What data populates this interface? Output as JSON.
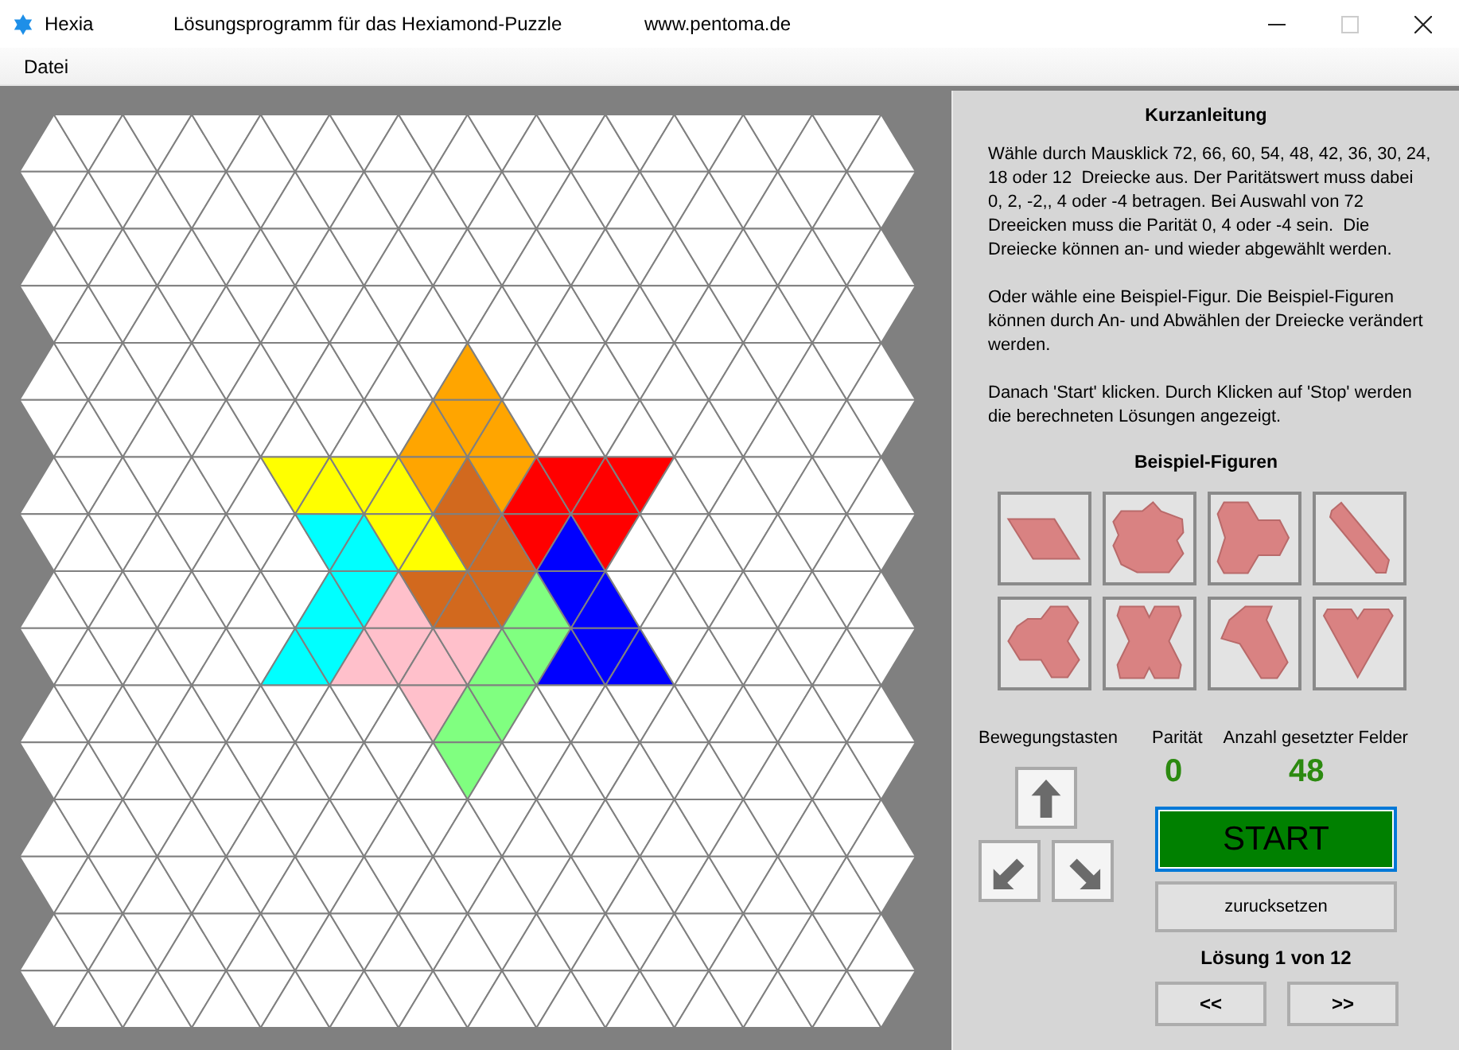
{
  "window": {
    "app_name": "Hexia",
    "title": "Lösungsprogramm für das Hexiamond-Puzzle",
    "url": "www.pentoma.de",
    "controls": [
      {
        "kind": "minimize",
        "disabled": false
      },
      {
        "kind": "maximize",
        "disabled": true
      },
      {
        "kind": "close",
        "disabled": false
      }
    ]
  },
  "menu": [
    "Datei"
  ],
  "board": {
    "rows": [
      {
        "cells": [
          {
            "selected": false
          },
          {
            "selected": false
          },
          {
            "selected": false
          },
          {
            "selected": false
          },
          {
            "selected": false
          },
          {
            "selected": false
          },
          {
            "selected": false
          },
          {
            "selected": false
          },
          {
            "selected": false
          },
          {
            "selected": false
          },
          {
            "selected": false
          },
          {
            "selected": false
          },
          {
            "selected": false
          },
          {
            "selected": false
          },
          {
            "selected": false
          },
          {
            "selected": false
          },
          {
            "selected": false
          },
          {
            "selected": false
          },
          {
            "selected": false
          },
          {
            "selected": false
          },
          {
            "selected": false
          },
          {
            "selected": false
          },
          {
            "selected": false
          },
          {
            "selected": false
          },
          {
            "selected": false
          }
        ]
      },
      {
        "cells": [
          {
            "selected": false
          },
          {
            "selected": false
          },
          {
            "selected": false
          },
          {
            "selected": false
          },
          {
            "selected": false
          },
          {
            "selected": false
          },
          {
            "selected": false
          },
          {
            "selected": false
          },
          {
            "selected": false
          },
          {
            "selected": false
          },
          {
            "selected": false
          },
          {
            "selected": false
          },
          {
            "selected": false
          },
          {
            "selected": false
          },
          {
            "selected": false
          },
          {
            "selected": false
          },
          {
            "selected": false
          },
          {
            "selected": false
          },
          {
            "selected": false
          },
          {
            "selected": false
          },
          {
            "selected": false
          },
          {
            "selected": false
          },
          {
            "selected": false
          },
          {
            "selected": false
          },
          {
            "selected": false
          }
        ]
      },
      {
        "cells": [
          {
            "selected": false
          },
          {
            "selected": false
          },
          {
            "selected": false
          },
          {
            "selected": false
          },
          {
            "selected": false
          },
          {
            "selected": false
          },
          {
            "selected": false
          },
          {
            "selected": false
          },
          {
            "selected": false
          },
          {
            "selected": false
          },
          {
            "selected": false
          },
          {
            "selected": false
          },
          {
            "selected": false
          },
          {
            "selected": false
          },
          {
            "selected": false
          },
          {
            "selected": false
          },
          {
            "selected": false
          },
          {
            "selected": false
          },
          {
            "selected": false
          },
          {
            "selected": false
          },
          {
            "selected": false
          },
          {
            "selected": false
          },
          {
            "selected": false
          },
          {
            "selected": false
          },
          {
            "selected": false
          }
        ]
      },
      {
        "cells": [
          {
            "selected": false
          },
          {
            "selected": false
          },
          {
            "selected": false
          },
          {
            "selected": false
          },
          {
            "selected": false
          },
          {
            "selected": false
          },
          {
            "selected": false
          },
          {
            "selected": false
          },
          {
            "selected": false
          },
          {
            "selected": false
          },
          {
            "selected": false
          },
          {
            "selected": false
          },
          {
            "selected": false
          },
          {
            "selected": false
          },
          {
            "selected": false
          },
          {
            "selected": false
          },
          {
            "selected": false
          },
          {
            "selected": false
          },
          {
            "selected": false
          },
          {
            "selected": false
          },
          {
            "selected": false
          },
          {
            "selected": false
          },
          {
            "selected": false
          },
          {
            "selected": false
          },
          {
            "selected": false
          }
        ]
      },
      {
        "cells": [
          {
            "selected": false
          },
          {
            "selected": false
          },
          {
            "selected": false
          },
          {
            "selected": false
          },
          {
            "selected": false
          },
          {
            "selected": false
          },
          {
            "selected": false
          },
          {
            "selected": false
          },
          {
            "selected": false
          },
          {
            "selected": false
          },
          {
            "selected": false
          },
          {
            "selected": false
          },
          {
            "selected": true,
            "color": "#ffa500"
          },
          {
            "selected": false
          },
          {
            "selected": false
          },
          {
            "selected": false
          },
          {
            "selected": false
          },
          {
            "selected": false
          },
          {
            "selected": false
          },
          {
            "selected": false
          },
          {
            "selected": false
          },
          {
            "selected": false
          },
          {
            "selected": false
          },
          {
            "selected": false
          },
          {
            "selected": false
          }
        ]
      },
      {
        "cells": [
          {
            "selected": false
          },
          {
            "selected": false
          },
          {
            "selected": false
          },
          {
            "selected": false
          },
          {
            "selected": false
          },
          {
            "selected": false
          },
          {
            "selected": false
          },
          {
            "selected": false
          },
          {
            "selected": false
          },
          {
            "selected": false
          },
          {
            "selected": false
          },
          {
            "selected": true,
            "color": "#ffa500"
          },
          {
            "selected": true,
            "color": "#ffa500"
          },
          {
            "selected": true,
            "color": "#ffa500"
          },
          {
            "selected": false
          },
          {
            "selected": false
          },
          {
            "selected": false
          },
          {
            "selected": false
          },
          {
            "selected": false
          },
          {
            "selected": false
          },
          {
            "selected": false
          },
          {
            "selected": false
          },
          {
            "selected": false
          },
          {
            "selected": false
          },
          {
            "selected": false
          }
        ]
      },
      {
        "cells": [
          {
            "selected": false
          },
          {
            "selected": false
          },
          {
            "selected": false
          },
          {
            "selected": false
          },
          {
            "selected": false
          },
          {
            "selected": false
          },
          {
            "selected": false
          },
          {
            "selected": true,
            "color": "#ffff00"
          },
          {
            "selected": true,
            "color": "#ffff00"
          },
          {
            "selected": true,
            "color": "#ffff00"
          },
          {
            "selected": true,
            "color": "#ffff00"
          },
          {
            "selected": true,
            "color": "#ffa500"
          },
          {
            "selected": true,
            "color": "#d2691e"
          },
          {
            "selected": true,
            "color": "#ffa500"
          },
          {
            "selected": true,
            "color": "#ff0000"
          },
          {
            "selected": true,
            "color": "#ff0000"
          },
          {
            "selected": true,
            "color": "#ff0000"
          },
          {
            "selected": true,
            "color": "#ff0000"
          },
          {
            "selected": false
          },
          {
            "selected": false
          },
          {
            "selected": false
          },
          {
            "selected": false
          },
          {
            "selected": false
          },
          {
            "selected": false
          },
          {
            "selected": false
          }
        ]
      },
      {
        "cells": [
          {
            "selected": false
          },
          {
            "selected": false
          },
          {
            "selected": false
          },
          {
            "selected": false
          },
          {
            "selected": false
          },
          {
            "selected": false
          },
          {
            "selected": false
          },
          {
            "selected": false
          },
          {
            "selected": true,
            "color": "#00ffff"
          },
          {
            "selected": true,
            "color": "#00ffff"
          },
          {
            "selected": true,
            "color": "#ffff00"
          },
          {
            "selected": true,
            "color": "#ffff00"
          },
          {
            "selected": true,
            "color": "#d2691e"
          },
          {
            "selected": true,
            "color": "#d2691e"
          },
          {
            "selected": true,
            "color": "#ff0000"
          },
          {
            "selected": true,
            "color": "#0000ff"
          },
          {
            "selected": true,
            "color": "#ff0000"
          },
          {
            "selected": false
          },
          {
            "selected": false
          },
          {
            "selected": false
          },
          {
            "selected": false
          },
          {
            "selected": false
          },
          {
            "selected": false
          },
          {
            "selected": false
          },
          {
            "selected": false
          }
        ]
      },
      {
        "cells": [
          {
            "selected": false
          },
          {
            "selected": false
          },
          {
            "selected": false
          },
          {
            "selected": false
          },
          {
            "selected": false
          },
          {
            "selected": false
          },
          {
            "selected": false
          },
          {
            "selected": false
          },
          {
            "selected": true,
            "color": "#00ffff"
          },
          {
            "selected": true,
            "color": "#00ffff"
          },
          {
            "selected": true,
            "color": "#ffc0cb"
          },
          {
            "selected": true,
            "color": "#d2691e"
          },
          {
            "selected": true,
            "color": "#d2691e"
          },
          {
            "selected": true,
            "color": "#d2691e"
          },
          {
            "selected": true,
            "color": "#80ff80"
          },
          {
            "selected": true,
            "color": "#0000ff"
          },
          {
            "selected": true,
            "color": "#0000ff"
          },
          {
            "selected": false
          },
          {
            "selected": false
          },
          {
            "selected": false
          },
          {
            "selected": false
          },
          {
            "selected": false
          },
          {
            "selected": false
          },
          {
            "selected": false
          },
          {
            "selected": false
          }
        ]
      },
      {
        "cells": [
          {
            "selected": false
          },
          {
            "selected": false
          },
          {
            "selected": false
          },
          {
            "selected": false
          },
          {
            "selected": false
          },
          {
            "selected": false
          },
          {
            "selected": false
          },
          {
            "selected": true,
            "color": "#00ffff"
          },
          {
            "selected": true,
            "color": "#00ffff"
          },
          {
            "selected": true,
            "color": "#ffc0cb"
          },
          {
            "selected": true,
            "color": "#ffc0cb"
          },
          {
            "selected": true,
            "color": "#ffc0cb"
          },
          {
            "selected": true,
            "color": "#ffc0cb"
          },
          {
            "selected": true,
            "color": "#80ff80"
          },
          {
            "selected": true,
            "color": "#80ff80"
          },
          {
            "selected": true,
            "color": "#0000ff"
          },
          {
            "selected": true,
            "color": "#0000ff"
          },
          {
            "selected": true,
            "color": "#0000ff"
          },
          {
            "selected": false
          },
          {
            "selected": false
          },
          {
            "selected": false
          },
          {
            "selected": false
          },
          {
            "selected": false
          },
          {
            "selected": false
          },
          {
            "selected": false
          }
        ]
      },
      {
        "cells": [
          {
            "selected": false
          },
          {
            "selected": false
          },
          {
            "selected": false
          },
          {
            "selected": false
          },
          {
            "selected": false
          },
          {
            "selected": false
          },
          {
            "selected": false
          },
          {
            "selected": false
          },
          {
            "selected": false
          },
          {
            "selected": false
          },
          {
            "selected": false
          },
          {
            "selected": true,
            "color": "#ffc0cb"
          },
          {
            "selected": true,
            "color": "#80ff80"
          },
          {
            "selected": true,
            "color": "#80ff80"
          },
          {
            "selected": false
          },
          {
            "selected": false
          },
          {
            "selected": false
          },
          {
            "selected": false
          },
          {
            "selected": false
          },
          {
            "selected": false
          },
          {
            "selected": false
          },
          {
            "selected": false
          },
          {
            "selected": false
          },
          {
            "selected": false
          },
          {
            "selected": false
          }
        ]
      },
      {
        "cells": [
          {
            "selected": false
          },
          {
            "selected": false
          },
          {
            "selected": false
          },
          {
            "selected": false
          },
          {
            "selected": false
          },
          {
            "selected": false
          },
          {
            "selected": false
          },
          {
            "selected": false
          },
          {
            "selected": false
          },
          {
            "selected": false
          },
          {
            "selected": false
          },
          {
            "selected": false
          },
          {
            "selected": true,
            "color": "#80ff80"
          },
          {
            "selected": false
          },
          {
            "selected": false
          },
          {
            "selected": false
          },
          {
            "selected": false
          },
          {
            "selected": false
          },
          {
            "selected": false
          },
          {
            "selected": false
          },
          {
            "selected": false
          },
          {
            "selected": false
          },
          {
            "selected": false
          },
          {
            "selected": false
          },
          {
            "selected": false
          }
        ]
      },
      {
        "cells": [
          {
            "selected": false
          },
          {
            "selected": false
          },
          {
            "selected": false
          },
          {
            "selected": false
          },
          {
            "selected": false
          },
          {
            "selected": false
          },
          {
            "selected": false
          },
          {
            "selected": false
          },
          {
            "selected": false
          },
          {
            "selected": false
          },
          {
            "selected": false
          },
          {
            "selected": false
          },
          {
            "selected": false
          },
          {
            "selected": false
          },
          {
            "selected": false
          },
          {
            "selected": false
          },
          {
            "selected": false
          },
          {
            "selected": false
          },
          {
            "selected": false
          },
          {
            "selected": false
          },
          {
            "selected": false
          },
          {
            "selected": false
          },
          {
            "selected": false
          },
          {
            "selected": false
          },
          {
            "selected": false
          }
        ]
      },
      {
        "cells": [
          {
            "selected": false
          },
          {
            "selected": false
          },
          {
            "selected": false
          },
          {
            "selected": false
          },
          {
            "selected": false
          },
          {
            "selected": false
          },
          {
            "selected": false
          },
          {
            "selected": false
          },
          {
            "selected": false
          },
          {
            "selected": false
          },
          {
            "selected": false
          },
          {
            "selected": false
          },
          {
            "selected": false
          },
          {
            "selected": false
          },
          {
            "selected": false
          },
          {
            "selected": false
          },
          {
            "selected": false
          },
          {
            "selected": false
          },
          {
            "selected": false
          },
          {
            "selected": false
          },
          {
            "selected": false
          },
          {
            "selected": false
          },
          {
            "selected": false
          },
          {
            "selected": false
          },
          {
            "selected": false
          }
        ]
      },
      {
        "cells": [
          {
            "selected": false
          },
          {
            "selected": false
          },
          {
            "selected": false
          },
          {
            "selected": false
          },
          {
            "selected": false
          },
          {
            "selected": false
          },
          {
            "selected": false
          },
          {
            "selected": false
          },
          {
            "selected": false
          },
          {
            "selected": false
          },
          {
            "selected": false
          },
          {
            "selected": false
          },
          {
            "selected": false
          },
          {
            "selected": false
          },
          {
            "selected": false
          },
          {
            "selected": false
          },
          {
            "selected": false
          },
          {
            "selected": false
          },
          {
            "selected": false
          },
          {
            "selected": false
          },
          {
            "selected": false
          },
          {
            "selected": false
          },
          {
            "selected": false
          },
          {
            "selected": false
          },
          {
            "selected": false
          }
        ]
      },
      {
        "cells": [
          {
            "selected": false
          },
          {
            "selected": false
          },
          {
            "selected": false
          },
          {
            "selected": false
          },
          {
            "selected": false
          },
          {
            "selected": false
          },
          {
            "selected": false
          },
          {
            "selected": false
          },
          {
            "selected": false
          },
          {
            "selected": false
          },
          {
            "selected": false
          },
          {
            "selected": false
          },
          {
            "selected": false
          },
          {
            "selected": false
          },
          {
            "selected": false
          },
          {
            "selected": false
          },
          {
            "selected": false
          },
          {
            "selected": false
          },
          {
            "selected": false
          },
          {
            "selected": false
          },
          {
            "selected": false
          },
          {
            "selected": false
          },
          {
            "selected": false
          },
          {
            "selected": false
          },
          {
            "selected": false
          }
        ]
      }
    ]
  },
  "panel": {
    "heading": "Kurzanleitung",
    "paragraphs": [
      "Wähle durch Mausklick 72, 66, 60, 54, 48, 42, 36, 30, 24, 18 oder 12  Dreiecke aus. Der Paritätswert muss dabei  0, 2, -2,, 4 oder -4 betragen. Bei Auswahl von 72 Dreeicken muss die Parität 0, 4 oder -4 sein.  Die Dreiecke können an- und wieder abgewählt werden.",
      "Oder wähle eine Beispiel-Figur. Die Beispiel-Figuren können durch An- und Abwählen der Dreiecke verändert werden.",
      "Danach 'Start' klicken. Durch Klicken auf 'Stop' werden die berechneten Lösungen angezeigt."
    ],
    "examples_heading": "Beispiel-Figuren",
    "example_figures": [
      {
        "kind": "parallelogram"
      },
      {
        "kind": "star"
      },
      {
        "kind": "trefoil"
      },
      {
        "kind": "bar"
      },
      {
        "kind": "arrow"
      },
      {
        "kind": "cross"
      },
      {
        "kind": "wedge"
      },
      {
        "kind": "heart"
      }
    ],
    "movement_label": "Bewegungstasten",
    "movement_keys": [
      {
        "kind": "up"
      },
      {
        "kind": "down-left"
      },
      {
        "kind": "down-right"
      }
    ],
    "parity_label": "Parität",
    "parity_value": "0",
    "count_label": "Anzahl gesetzter Felder",
    "count_value": "48",
    "start_button": {
      "label": "START",
      "focused": true
    },
    "reset_button": "zurucksetzen",
    "solution_status": "Lösung 1 von 12",
    "prev_button": "<<",
    "next_button": ">>"
  }
}
